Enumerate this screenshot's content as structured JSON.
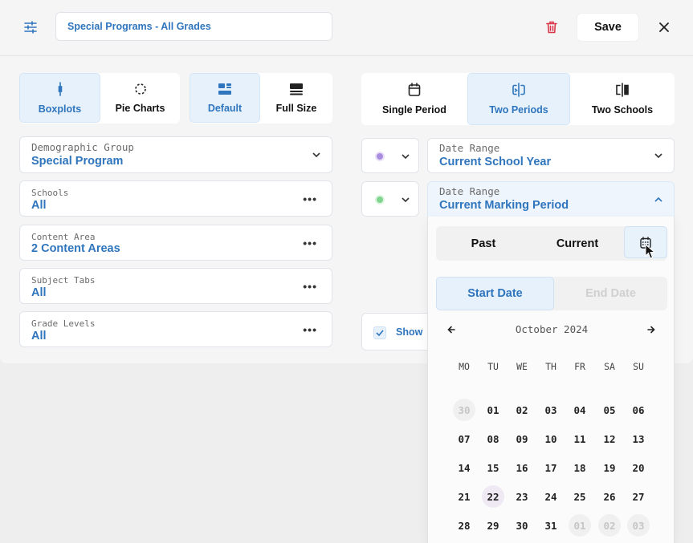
{
  "header": {
    "report_name": "Special Programs - All Grades",
    "save_label": "Save"
  },
  "chart_type": {
    "options": [
      {
        "label": "Boxplots",
        "active": true
      },
      {
        "label": "Pie Charts",
        "active": false
      }
    ]
  },
  "size": {
    "options": [
      {
        "label": "Default",
        "active": true
      },
      {
        "label": "Full Size",
        "active": false
      }
    ]
  },
  "period_mode": {
    "options": [
      {
        "label": "Single Period",
        "active": false
      },
      {
        "label": "Two Periods",
        "active": true
      },
      {
        "label": "Two Schools",
        "active": false
      }
    ]
  },
  "filters": {
    "demographic": {
      "label": "Demographic Group",
      "value": "Special Program"
    },
    "schools": {
      "label": "Schools",
      "value": "All"
    },
    "content_area": {
      "label": "Content Area",
      "value": "2 Content Areas"
    },
    "subject_tabs": {
      "label": "Subject Tabs",
      "value": "All"
    },
    "grade_levels": {
      "label": "Grade Levels",
      "value": "All"
    }
  },
  "periods": [
    {
      "color": "#a98ee0",
      "label": "Date Range",
      "value": "Current School Year"
    },
    {
      "color": "#7fd48e",
      "label": "Date Range",
      "value": "Current Marking Period"
    }
  ],
  "show_option": {
    "label": "Show",
    "checked": true
  },
  "picker": {
    "tabs": [
      "Past",
      "Current"
    ],
    "start_label": "Start Date",
    "end_label": "End Date",
    "month": "October 2024",
    "weekdays": [
      "MO",
      "TU",
      "WE",
      "TH",
      "FR",
      "SA",
      "SU"
    ],
    "weeks": [
      [
        "30",
        "01",
        "02",
        "03",
        "04",
        "05",
        "06"
      ],
      [
        "07",
        "08",
        "09",
        "10",
        "11",
        "12",
        "13"
      ],
      [
        "14",
        "15",
        "16",
        "17",
        "18",
        "19",
        "20"
      ],
      [
        "21",
        "22",
        "23",
        "24",
        "25",
        "26",
        "27"
      ],
      [
        "28",
        "29",
        "30",
        "31",
        "01",
        "02",
        "03"
      ]
    ],
    "outside": [
      [
        0,
        0
      ],
      [
        4,
        4
      ],
      [
        4,
        5
      ],
      [
        4,
        6
      ]
    ],
    "highlighted": [
      3,
      1
    ]
  },
  "colors": {
    "accent": "#2f75bd",
    "delete": "#d9364a",
    "active_bg": "#e6f1fb"
  }
}
